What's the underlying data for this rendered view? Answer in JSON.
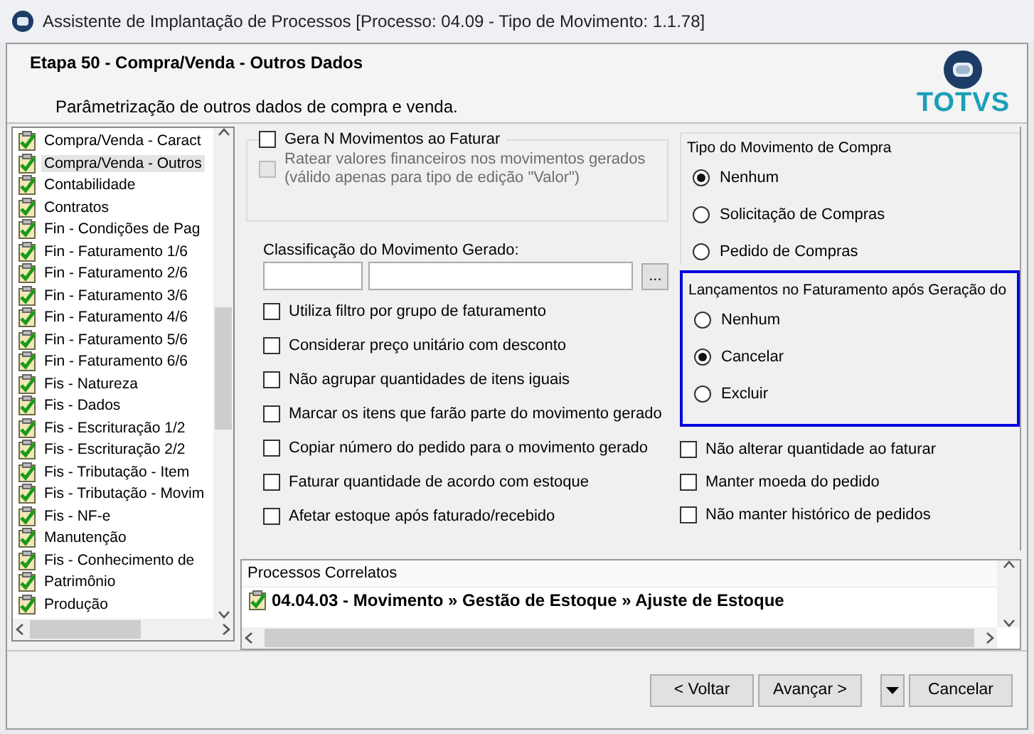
{
  "window": {
    "title": "Assistente de Implantação de Processos [Processo: 04.09 - Tipo de Movimento: 1.1.78]"
  },
  "header": {
    "title": "Etapa 50 - Compra/Venda - Outros Dados",
    "description": "Parâmetrização de outros dados de compra e venda.",
    "logo": "TOTVS"
  },
  "steps": [
    {
      "label": "Compra/Venda - Caract",
      "selected": false
    },
    {
      "label": "Compra/Venda - Outros",
      "selected": true
    },
    {
      "label": "Contabilidade",
      "selected": false
    },
    {
      "label": "Contratos",
      "selected": false
    },
    {
      "label": "Fin - Condições de Pag",
      "selected": false
    },
    {
      "label": "Fin - Faturamento 1/6",
      "selected": false
    },
    {
      "label": "Fin - Faturamento 2/6",
      "selected": false
    },
    {
      "label": "Fin - Faturamento 3/6",
      "selected": false
    },
    {
      "label": "Fin - Faturamento 4/6",
      "selected": false
    },
    {
      "label": "Fin - Faturamento 5/6",
      "selected": false
    },
    {
      "label": "Fin - Faturamento 6/6",
      "selected": false
    },
    {
      "label": "Fis - Natureza",
      "selected": false
    },
    {
      "label": "Fis - Dados",
      "selected": false
    },
    {
      "label": "Fis - Escrituração 1/2",
      "selected": false
    },
    {
      "label": "Fis - Escrituração 2/2",
      "selected": false
    },
    {
      "label": "Fis - Tributação - Item",
      "selected": false
    },
    {
      "label": "Fis - Tributação - Movim",
      "selected": false
    },
    {
      "label": "Fis - NF-e",
      "selected": false
    },
    {
      "label": "Manutenção",
      "selected": false
    },
    {
      "label": "Fis - Conhecimento de",
      "selected": false
    },
    {
      "label": "Patrimônio",
      "selected": false
    },
    {
      "label": "Produção",
      "selected": false
    }
  ],
  "gera_group": {
    "label": "Gera N Movimentos ao Faturar",
    "checked": false,
    "ratear": {
      "label": "Ratear valores financeiros nos movimentos gerados\n(válido apenas para tipo de edição \"Valor\")",
      "checked": false,
      "disabled": true
    }
  },
  "classificacao": {
    "label": "Classificação do Movimento Gerado:",
    "browse": "..."
  },
  "options": [
    {
      "label": "Utiliza filtro por grupo de faturamento",
      "checked": false
    },
    {
      "label": "Considerar preço unitário com desconto",
      "checked": false
    },
    {
      "label": "Não agrupar quantidades de itens iguais",
      "checked": false
    },
    {
      "label": "Marcar os itens que farão parte do movimento gerado",
      "checked": false
    },
    {
      "label": "Copiar número do pedido para o movimento gerado",
      "checked": false
    },
    {
      "label": "Faturar quantidade de acordo com estoque",
      "checked": false
    },
    {
      "label": "Afetar estoque após faturado/recebido",
      "checked": false
    }
  ],
  "tipo_movimento": {
    "title": "Tipo do Movimento de Compra",
    "focused": false,
    "options": [
      {
        "label": "Nenhum",
        "selected": true
      },
      {
        "label": "Solicitação de Compras",
        "selected": false
      },
      {
        "label": "Pedido de Compras",
        "selected": false
      }
    ]
  },
  "lancamentos": {
    "title": "Lançamentos no Faturamento após Geração do",
    "focused": true,
    "options": [
      {
        "label": "Nenhum",
        "selected": false
      },
      {
        "label": "Cancelar",
        "selected": true
      },
      {
        "label": "Excluir",
        "selected": false
      }
    ]
  },
  "right_options": [
    {
      "label": "Não alterar quantidade ao faturar",
      "checked": false
    },
    {
      "label": "Manter moeda do pedido",
      "checked": false
    },
    {
      "label": "Não manter histórico de pedidos",
      "checked": false
    }
  ],
  "processos_correlatos": {
    "title": "Processos Correlatos",
    "items": [
      "04.04.03 - Movimento » Gestão de Estoque » Ajuste de Estoque"
    ]
  },
  "buttons": {
    "back": "< Voltar",
    "next": "Avançar >",
    "cancel": "Cancelar"
  }
}
